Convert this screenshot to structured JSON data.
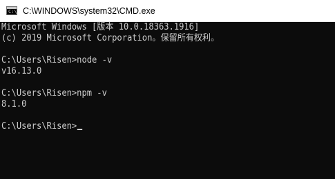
{
  "window": {
    "title": "C:\\WINDOWS\\system32\\CMD.exe",
    "icon": "cmd-console-icon"
  },
  "console": {
    "lines": [
      "Microsoft Windows [版本 10.0.18363.1916]",
      "(c) 2019 Microsoft Corporation。保留所有权利。",
      "",
      "C:\\Users\\Risen>node -v",
      "v16.13.0",
      "",
      "C:\\Users\\Risen>npm -v",
      "8.1.0",
      ""
    ],
    "prompt": "C:\\Users\\Risen>"
  },
  "colors": {
    "background": "#0c0c0c",
    "foreground": "#cccccc",
    "titlebar": "#ffffff"
  }
}
